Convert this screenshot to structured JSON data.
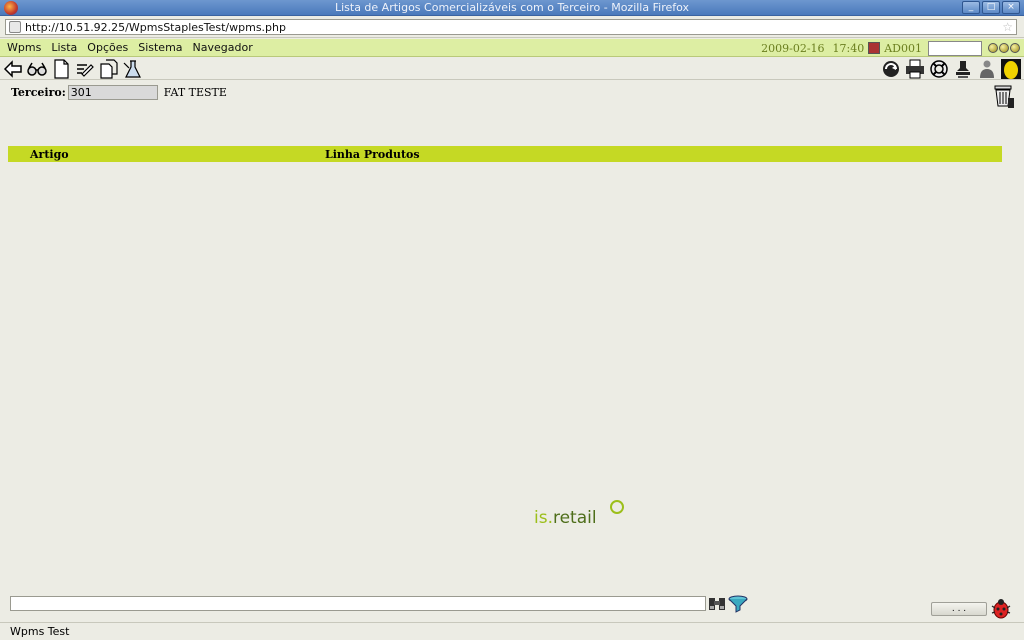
{
  "window": {
    "title": "Lista de Artigos Comercializáveis com o Terceiro - Mozilla Firefox",
    "controls": [
      "_",
      "□",
      "×"
    ]
  },
  "browser": {
    "url": "http://10.51.92.25/WpmsStaplesTest/wpms.php",
    "status": "Wpms Test"
  },
  "menu": {
    "items": [
      "Wpms",
      "Lista",
      "Opções",
      "Sistema",
      "Navegador"
    ],
    "date": "2009-02-16",
    "time": "17:40",
    "user": "AD001"
  },
  "form": {
    "terceiro_label": "Terceiro:",
    "terceiro_value": "301",
    "terceiro_desc": "FAT TESTE"
  },
  "grid": {
    "columns": [
      "Artigo",
      "Linha Produtos"
    ]
  },
  "logo": {
    "text_prefix": "is.",
    "text_suffix": "retail"
  },
  "footer": {
    "ellipsis_label": ". . ."
  },
  "colors": {
    "menu_bg": "#ddeea3",
    "grid_header": "#c5d924",
    "accent_text": "#6b7f1f"
  },
  "icons": {
    "toolbar_left": [
      "back-arrow-icon",
      "glasses-icon",
      "new-document-icon",
      "edit-icon",
      "copy-document-icon",
      "chemistry-icon"
    ],
    "toolbar_right": [
      "refresh-icon",
      "print-icon",
      "help-lifebuoy-icon",
      "stamp-icon",
      "person-icon",
      "egg-icon"
    ]
  }
}
